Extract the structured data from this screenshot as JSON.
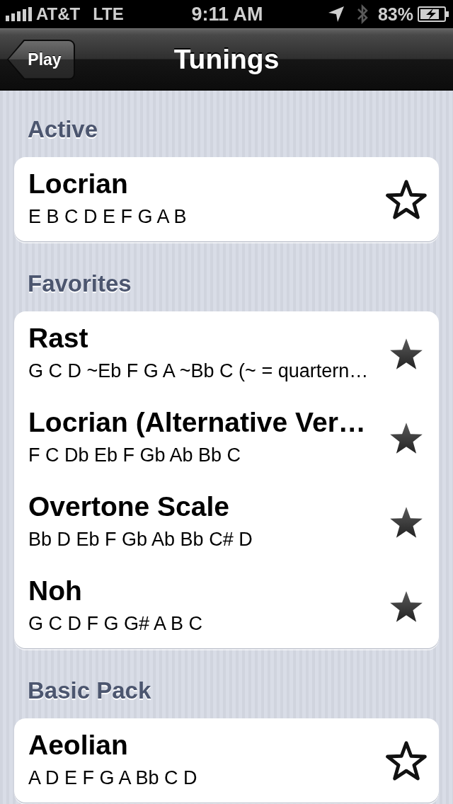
{
  "status_bar": {
    "carrier": "AT&T",
    "network": "LTE",
    "time": "9:11 AM",
    "battery": "83%"
  },
  "nav_bar": {
    "back_button": "Play",
    "title": "Tunings"
  },
  "sections": [
    {
      "header": "Active",
      "items": [
        {
          "name": "Locrian",
          "notes": "E B C D E F G A B",
          "favorite": false
        }
      ]
    },
    {
      "header": "Favorites",
      "items": [
        {
          "name": "Rast",
          "notes": "G C D ~Eb F G A ~Bb C (~ = quartern…",
          "favorite": true
        },
        {
          "name": "Locrian (Alternative Ver…",
          "notes": "F C Db Eb F Gb Ab Bb C",
          "favorite": true
        },
        {
          "name": "Overtone Scale",
          "notes": "Bb D Eb F Gb Ab Bb C# D",
          "favorite": true
        },
        {
          "name": "Noh",
          "notes": "G C D F G G# A B C",
          "favorite": true
        }
      ]
    },
    {
      "header": "Basic Pack",
      "items": [
        {
          "name": "Aeolian",
          "notes": "A D E F G A Bb C D",
          "favorite": false
        }
      ]
    }
  ]
}
